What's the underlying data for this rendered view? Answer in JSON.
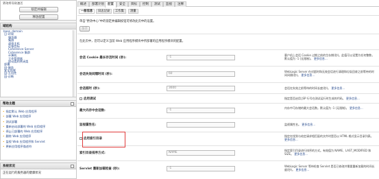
{
  "left": {
    "top_panel": {
      "line1": "更改将导致激活",
      "button1": "锁定并编辑",
      "button2": "释放配置"
    },
    "tree": {
      "title": "域结构",
      "items": [
        "base_domain",
        "日-环境",
        "服务器",
        "集群",
        "虚拟主机",
        "迁移目标",
        "Coherence Server",
        "Coherence 集群",
        "计算机",
        "工作管理器",
        "启动类和关闭类",
        "部署",
        "田-服务",
        "安全领域",
        "田-互用性",
        "田-诊断"
      ]
    },
    "help": {
      "title": "帮助主题",
      "links": [
        "指定默认 Web 应用程序",
        "部署 Web 应用程序",
        "测试部署",
        "重新启动部署的 Web 应用程序",
        "停止已部署的 Web 应用程序",
        "删除 Web 应用程序",
        "监视 Web 应用程序和 Servlet",
        "更新应用程序描述符"
      ]
    },
    "status": {
      "title": "系统状况",
      "subtitle": "正在运行的服务器的健康状况"
    }
  },
  "main": {
    "tabs": [
      "概述",
      "部署计划",
      "配置",
      "安全",
      "目标",
      "控制",
      "测试",
      "监视",
      "注释"
    ],
    "active_tab": "配置",
    "subtabs": [
      "一般信息",
      "日志记录",
      "工作集",
      "测量"
    ],
    "intro": "单击\"更改中心\"中的锁定并编辑按钮可修改此页中的设置。",
    "save_label": "保存",
    "desc": "在此页中，您可以定义当前 Web 应用程序模块中所部署的应用程序模块的配置。",
    "fields": [
      {
        "label": "会话 Cookie 最长存活时间 (秒):",
        "value": "-1",
        "desc": "客户机上会话 Cookie 过期之前的生存期(秒)。此值可以设置为任何整数，默认值为 -1 (无限制)。",
        "more": "更多信息..."
      },
      {
        "label": "会话失效间隔时间 (秒):",
        "value": "60",
        "desc": "WebLogic Server 在对超时和无效会话进行清理和垃圾回收之前等待的时间间隔(秒)。",
        "more": "更多信息..."
      },
      {
        "label": "会话超时 (秒):",
        "value": "3600",
        "desc": "会话在失效之前等待的时间长度(秒)。",
        "more": "更多信息..."
      },
      {
        "label": "启用调试",
        "value": "",
        "desc": "指定是否启用 JSP 行号在测试运行时生成的代码。",
        "more": "更多信息..."
      },
      {
        "label": "最大内存中会话数:",
        "value": "-1",
        "desc": "内存中可存储的最大会话数。默认值为 -1 (无限制)。",
        "more": "更多信息..."
      },
      {
        "label": "监视属性名:",
        "value": "",
        "desc": "监视属性名。",
        "more": "更多信息..."
      },
      {
        "label": "启用索引目录",
        "value": "",
        "desc": "指定在找到与给定请求相匹配的文件时是否以 HTML 格式显示目录列表。",
        "more": "更多信息..."
      },
      {
        "label": "索引目录排序方式:",
        "value": "NAME",
        "desc": "指定索引目录进行排序的方式。有效值为 NAME、LAST_MODIFIED 和 SIZE。",
        "more": "更多信息..."
      },
      {
        "label": "Servlet 重新加载检查 (秒):",
        "value": "-1",
        "desc": "WebLogic Server 等待检查 Servlet 是否已修改并需要重新加载的时间长度(秒)。",
        "more": "更多信息..."
      }
    ]
  },
  "colors": {
    "highlight": "#e03a3a",
    "link": "#2a4d8f"
  }
}
